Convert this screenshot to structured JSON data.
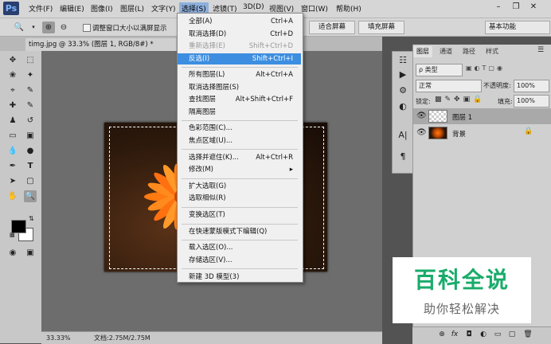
{
  "app": {
    "logo": "Ps"
  },
  "menubar": {
    "items": [
      "文件(F)",
      "编辑(E)",
      "图像(I)",
      "图层(L)",
      "文字(Y)",
      "选择(S)",
      "滤镜(T)",
      "3D(D)",
      "视图(V)",
      "窗口(W)",
      "帮助(H)"
    ],
    "active_index": 5
  },
  "window_controls": {
    "minimize": "–",
    "restore": "❐",
    "close": "✕"
  },
  "options_bar": {
    "checkbox_label": "调整窗口大小以满屏显示",
    "fit_screen": "适合屏幕",
    "fill_screen": "填充屏幕",
    "workspace": "基本功能"
  },
  "document": {
    "tab_title": "timg.jpg @ 33.3% (图层 1, RGB/8#) *"
  },
  "status_bar": {
    "zoom": "33.33%",
    "doc_info": "文档:2.75M/2.75M"
  },
  "select_menu": {
    "groups": [
      [
        {
          "label": "全部(A)",
          "shortcut": "Ctrl+A"
        },
        {
          "label": "取消选择(D)",
          "shortcut": "Ctrl+D"
        },
        {
          "label": "重新选择(E)",
          "shortcut": "Shift+Ctrl+D",
          "disabled": true
        },
        {
          "label": "反选(I)",
          "shortcut": "Shift+Ctrl+I",
          "highlighted": true
        }
      ],
      [
        {
          "label": "所有图层(L)",
          "shortcut": "Alt+Ctrl+A"
        },
        {
          "label": "取消选择图层(S)",
          "shortcut": ""
        },
        {
          "label": "查找图层",
          "shortcut": "Alt+Shift+Ctrl+F"
        },
        {
          "label": "隔离图层",
          "shortcut": ""
        }
      ],
      [
        {
          "label": "色彩范围(C)...",
          "shortcut": ""
        },
        {
          "label": "焦点区域(U)...",
          "shortcut": ""
        }
      ],
      [
        {
          "label": "选择并遮住(K)...",
          "shortcut": "Alt+Ctrl+R"
        },
        {
          "label": "修改(M)",
          "shortcut": "▸"
        }
      ],
      [
        {
          "label": "扩大选取(G)",
          "shortcut": ""
        },
        {
          "label": "选取相似(R)",
          "shortcut": ""
        }
      ],
      [
        {
          "label": "变换选区(T)",
          "shortcut": ""
        }
      ],
      [
        {
          "label": "在快速蒙版模式下编辑(Q)",
          "shortcut": ""
        }
      ],
      [
        {
          "label": "载入选区(O)...",
          "shortcut": ""
        },
        {
          "label": "存储选区(V)...",
          "shortcut": ""
        }
      ],
      [
        {
          "label": "新建 3D 模型(3)",
          "shortcut": ""
        }
      ]
    ]
  },
  "layers_panel": {
    "tabs": [
      "图层",
      "通道",
      "路径",
      "样式"
    ],
    "filter": "ρ 类型",
    "blend_mode": "正常",
    "opacity_label": "不透明度:",
    "opacity_value": "100%",
    "lock_label": "锁定:",
    "fill_label": "填充:",
    "fill_value": "100%",
    "layers": [
      {
        "name": "图层 1",
        "selected": true
      },
      {
        "name": "背景",
        "locked": true
      }
    ],
    "footer": [
      "⊕",
      "fx",
      "◘",
      "◐",
      "▭",
      "▢",
      "🗑"
    ]
  },
  "watermark": {
    "title": "百科全说",
    "subtitle": "助你轻松解决"
  },
  "colors": {
    "menu_highlight": "#3d8ee0",
    "watermark_green": "#1aab6b"
  }
}
